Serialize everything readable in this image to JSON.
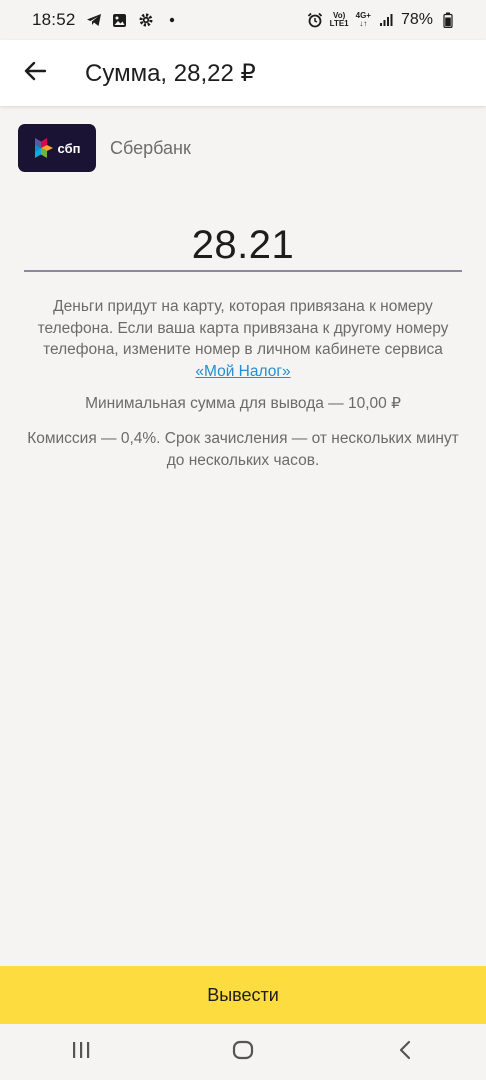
{
  "status_bar": {
    "time": "18:52",
    "left_icons": [
      "telegram-icon",
      "gallery-icon",
      "settings-icon",
      "dot-icon"
    ],
    "right_icons": [
      "alarm-icon",
      "volte-icon",
      "network-4g-icon",
      "signal-icon",
      "battery-icon"
    ],
    "volte_label_top": "Vo)",
    "volte_label_bottom": "LTE1",
    "network_label": "4G+",
    "battery_percent": "78%"
  },
  "app_bar": {
    "title": "Сумма, 28,22 ₽",
    "back_icon": "arrow-left-icon"
  },
  "bank": {
    "logo_text": "сбп",
    "name": "Сбербанк"
  },
  "amount": {
    "value": "28.21"
  },
  "info": {
    "text_before_link": "Деньги придут на карту, которая привязана к номеру телефона. Если ваша карта привязана к другому номеру телефона, измените номер в личном кабинете сервиса",
    "link_text": "«Мой Налог»",
    "min_sum": "Минимальная сумма для вывода — 10,00 ₽",
    "commission": "Комиссия — 0,4%. Срок зачисления — от нескольких минут до нескольких часов."
  },
  "withdraw_button": {
    "label": "Вывести",
    "color": "#fcdc3e"
  },
  "nav_bar": {
    "items": [
      "recents-icon",
      "home-icon",
      "back-icon"
    ]
  },
  "colors": {
    "background": "#f5f4f2",
    "link": "#1f8fd6",
    "accent": "#fcdc3e",
    "logo_bg": "#1b1333"
  }
}
